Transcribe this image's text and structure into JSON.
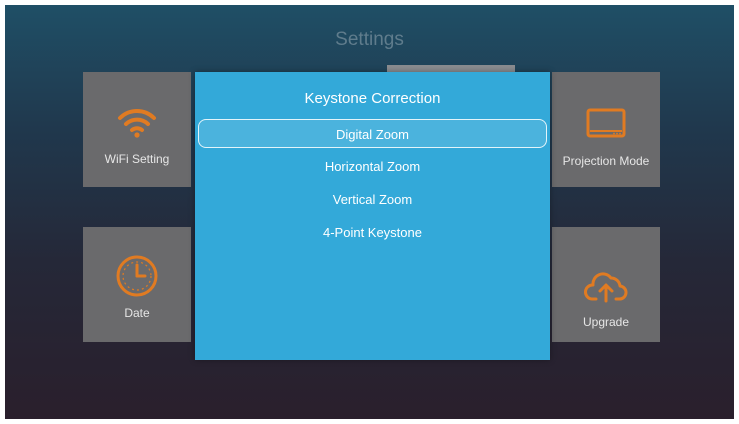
{
  "page": {
    "title": "Settings"
  },
  "tiles": {
    "wifi": {
      "label": "WiFi Setting",
      "icon": "wifi-icon"
    },
    "date": {
      "label": "Date",
      "icon": "clock-icon"
    },
    "projection": {
      "label": "Projection Mode",
      "icon": "screen-icon"
    },
    "upgrade": {
      "label": "Upgrade",
      "icon": "cloud-upload-icon"
    }
  },
  "dialog": {
    "title": "Keystone Correction",
    "items": [
      {
        "label": "Digital Zoom",
        "selected": true
      },
      {
        "label": "Horizontal Zoom",
        "selected": false
      },
      {
        "label": "Vertical Zoom",
        "selected": false
      },
      {
        "label": "4-Point Keystone",
        "selected": false
      }
    ]
  },
  "colors": {
    "accent": "#e07b22",
    "dialog_bg": "#33a9d9",
    "tile_bg": "#6a6a6c"
  }
}
